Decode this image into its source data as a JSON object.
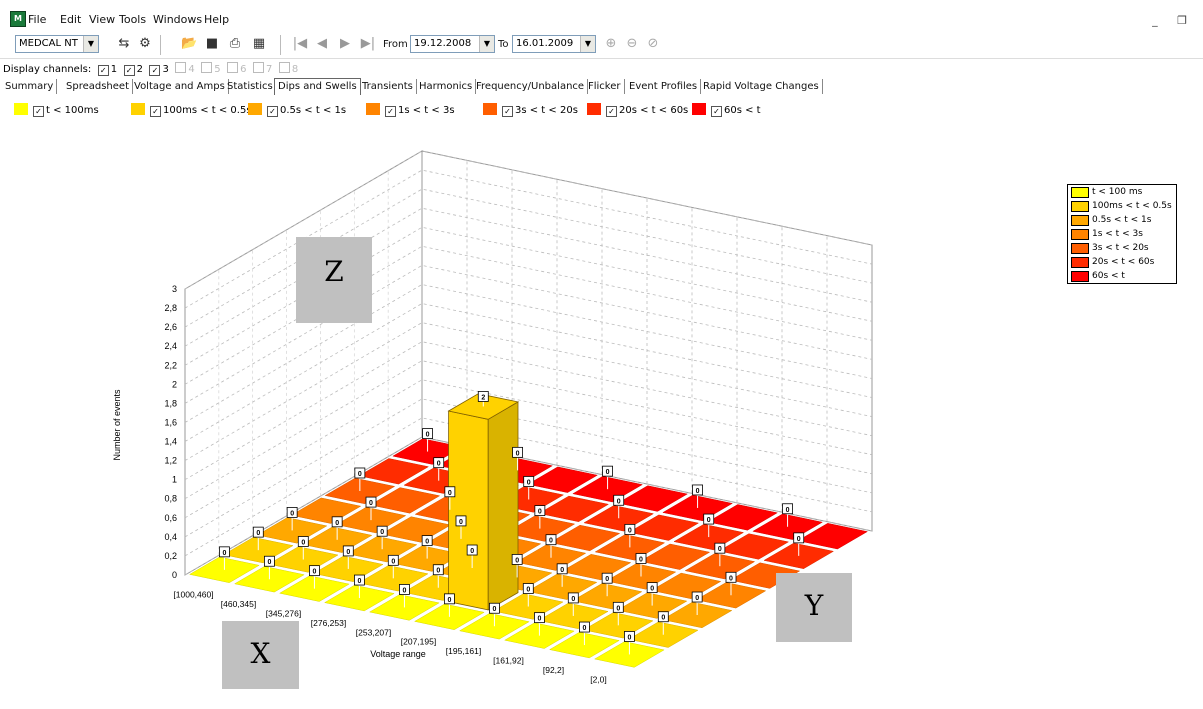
{
  "menu": [
    "File",
    "Edit",
    "View",
    "Tools",
    "Windows",
    "Help"
  ],
  "window_controls": "_ ❐",
  "toolbar": {
    "device": "MEDCAL NT",
    "from_label": "From",
    "from_date": "19.12.2008",
    "to_label": "To",
    "to_date": "16.01.2009"
  },
  "channels": {
    "label": "Display channels:",
    "items": [
      {
        "num": "1",
        "checked": true
      },
      {
        "num": "2",
        "checked": true
      },
      {
        "num": "3",
        "checked": true
      },
      {
        "num": "4",
        "checked": false
      },
      {
        "num": "5",
        "checked": false
      },
      {
        "num": "6",
        "checked": false
      },
      {
        "num": "7",
        "checked": false
      },
      {
        "num": "8",
        "checked": false
      }
    ]
  },
  "tabs": [
    "Summary",
    "Spreadsheet",
    "Voltage and Amps",
    "Statistics",
    "Dips and Swells",
    "Transients",
    "Harmonics",
    "Frequency/Unbalance",
    "Flicker",
    "Event Profiles",
    "Rapid Voltage Changes"
  ],
  "active_tab": "Dips and Swells",
  "duration_filters": [
    {
      "label": "t < 100ms",
      "color": "#ffff00",
      "checked": true
    },
    {
      "label": "100ms < t < 0.5s",
      "color": "#ffd200",
      "checked": true
    },
    {
      "label": "0.5s < t < 1s",
      "color": "#ffa800",
      "checked": true
    },
    {
      "label": "1s < t < 3s",
      "color": "#ff8400",
      "checked": true
    },
    {
      "label": "3s < t < 20s",
      "color": "#ff5e00",
      "checked": true
    },
    {
      "label": "20s < t < 60s",
      "color": "#ff2c00",
      "checked": true
    },
    {
      "label": "60s < t",
      "color": "#ff0000",
      "checked": true
    }
  ],
  "chart_data": {
    "type": "bar",
    "variant": "3d",
    "title": "",
    "xlabel": "Voltage range",
    "ylabel": "Number of events",
    "categories": [
      "[1000,460]",
      "[460,345]",
      "[345,276]",
      "[276,253]",
      "[253,207]",
      "[207,195]",
      "[195,161]",
      "[161,92]",
      "[92,2]",
      "[2,0]"
    ],
    "zlim": [
      0,
      3
    ],
    "z_ticks": [
      "0",
      "0,2",
      "0,4",
      "0,6",
      "0,8",
      "1",
      "1,2",
      "1,4",
      "1,6",
      "1,8",
      "2",
      "2,2",
      "2,4",
      "2,6",
      "2,8",
      "3"
    ],
    "series": [
      {
        "name": "t < 100 ms",
        "color": "#ffff00",
        "values": [
          0,
          0,
          0,
          0,
          0,
          0,
          0,
          0,
          0,
          0
        ]
      },
      {
        "name": "100ms < t < 0.5s",
        "color": "#ffd200",
        "values": [
          0,
          0,
          0,
          0,
          0,
          2,
          0,
          0,
          0,
          0
        ]
      },
      {
        "name": "0.5s < t < 1s",
        "color": "#ffa800",
        "values": [
          0,
          0,
          0,
          0,
          0,
          0,
          0,
          0,
          0,
          0
        ]
      },
      {
        "name": "1s < t < 3s",
        "color": "#ff8400",
        "values": [
          0,
          0,
          0,
          0,
          0,
          0,
          0,
          0,
          0,
          0
        ]
      },
      {
        "name": "3s < t < 20s",
        "color": "#ff5e00",
        "values": [
          0,
          0,
          0,
          0,
          0,
          0,
          0,
          0,
          0,
          0
        ]
      },
      {
        "name": "20s < t < 60s",
        "color": "#ff2c00",
        "values": [
          0,
          0,
          0,
          0,
          0,
          0,
          0,
          0,
          0,
          0
        ]
      },
      {
        "name": "60s < t",
        "color": "#ff0000",
        "values": [
          0,
          0,
          0,
          0,
          0,
          0,
          0,
          0,
          0,
          0
        ]
      }
    ],
    "legend": "right",
    "grid": true
  },
  "overlay_labels": {
    "z": "Z",
    "x": "X",
    "y": "Y"
  }
}
